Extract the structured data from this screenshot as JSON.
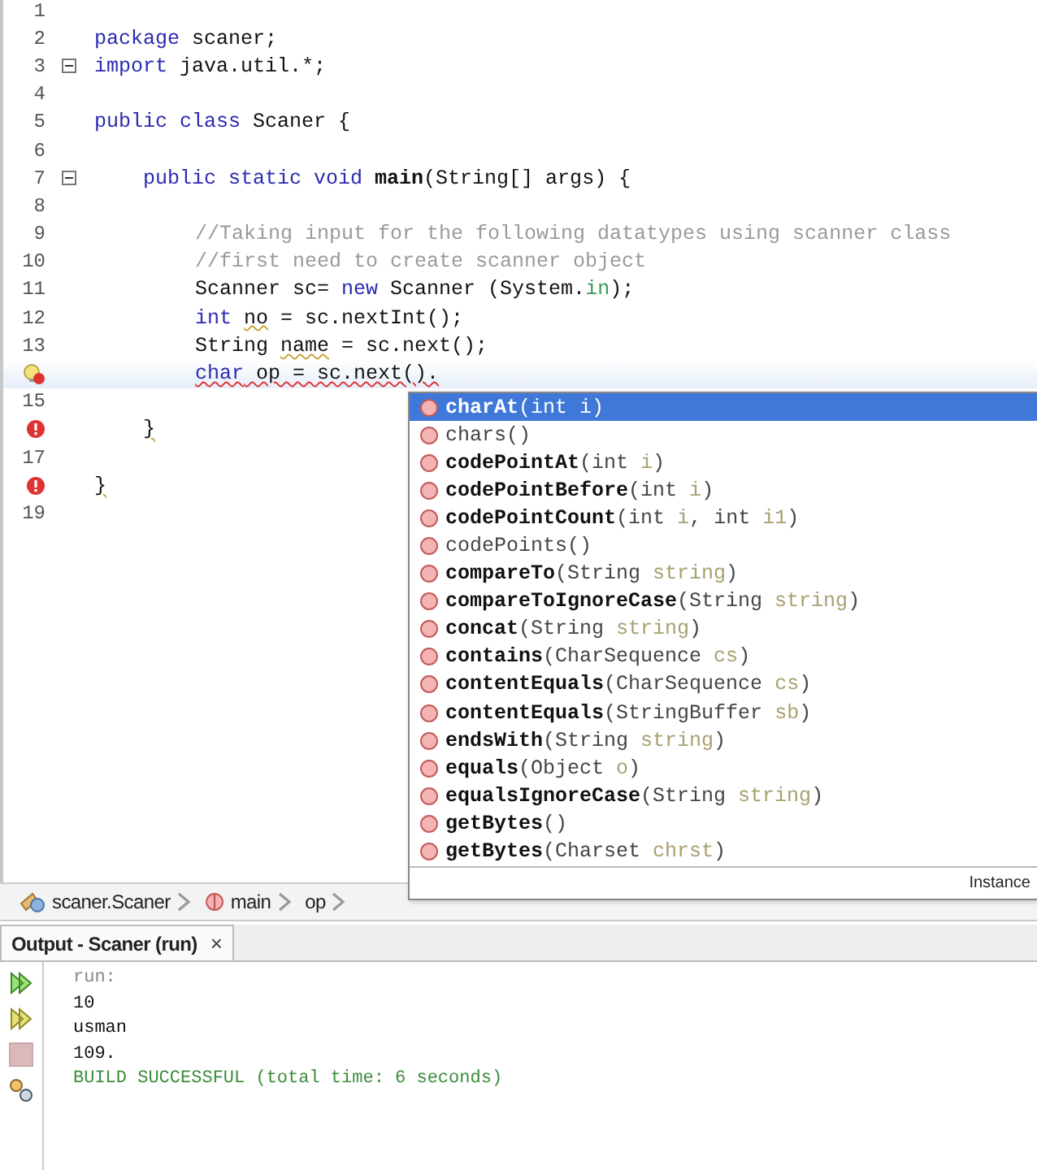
{
  "editor": {
    "lines": [
      {
        "number": "1",
        "error": false,
        "hint": false,
        "fold": false,
        "current": false
      },
      {
        "number": "2",
        "error": false,
        "hint": false,
        "fold": false,
        "current": false,
        "kind": "top",
        "segments": [
          {
            "kind": "keyword",
            "text": "package"
          },
          {
            "kind": "plain",
            "text": " scaner;"
          }
        ]
      },
      {
        "number": "3",
        "error": false,
        "hint": false,
        "fold": true,
        "current": false,
        "kind": "top",
        "segments": [
          {
            "kind": "keyword",
            "text": "import"
          },
          {
            "kind": "plain",
            "text": " java.util.*;"
          }
        ]
      },
      {
        "number": "4",
        "error": false,
        "hint": false,
        "fold": false,
        "current": false
      },
      {
        "number": "5",
        "error": false,
        "hint": false,
        "fold": false,
        "current": false,
        "kind": "top",
        "segments": [
          {
            "kind": "keyword",
            "text": "public class"
          },
          {
            "kind": "plain",
            "text": " Scaner {"
          }
        ]
      },
      {
        "number": "6",
        "error": false,
        "hint": false,
        "fold": false,
        "current": false
      },
      {
        "number": "7",
        "error": false,
        "hint": false,
        "fold": true,
        "current": false,
        "kind": "member",
        "segments": [
          {
            "kind": "keyword",
            "text": "public static void "
          },
          {
            "kind": "bold",
            "text": "main"
          },
          {
            "kind": "plain",
            "text": "(String[] args) {"
          }
        ]
      },
      {
        "number": "8",
        "error": false,
        "hint": false,
        "fold": false,
        "current": false
      },
      {
        "number": "9",
        "error": false,
        "hint": false,
        "fold": false,
        "current": false,
        "kind": "statement",
        "segments": [
          {
            "kind": "comment",
            "text": "//Taking input for the following datatypes using scanner class"
          }
        ]
      },
      {
        "number": "10",
        "error": false,
        "hint": false,
        "fold": false,
        "current": false,
        "kind": "statement",
        "segments": [
          {
            "kind": "comment",
            "text": "//first need to create scanner object"
          }
        ]
      },
      {
        "number": "11",
        "error": false,
        "hint": false,
        "fold": false,
        "current": false,
        "kind": "statement",
        "segments": [
          {
            "kind": "plain",
            "text": "Scanner sc= "
          },
          {
            "kind": "keyword",
            "text": "new"
          },
          {
            "kind": "plain",
            "text": " Scanner (System."
          },
          {
            "kind": "field",
            "text": "in"
          },
          {
            "kind": "plain",
            "text": ");"
          }
        ]
      },
      {
        "number": "12",
        "error": false,
        "hint": false,
        "fold": false,
        "current": false,
        "kind": "statement",
        "segments": [
          {
            "kind": "keyword",
            "text": "int "
          },
          {
            "kind": "plain",
            "text": "no",
            "warning": true
          },
          {
            "kind": "plain",
            "text": " = sc.nextInt();"
          }
        ]
      },
      {
        "number": "13",
        "error": false,
        "hint": false,
        "fold": false,
        "current": false,
        "kind": "statement",
        "segments": [
          {
            "kind": "plain",
            "text": "String "
          },
          {
            "kind": "plain",
            "text": "name",
            "warning": true
          },
          {
            "kind": "plain",
            "text": " = sc.next();"
          }
        ]
      },
      {
        "error": true,
        "hint": true,
        "fold": false,
        "current": true,
        "kind": "statement",
        "segments": [
          {
            "kind": "keyword",
            "text": "char",
            "error": true
          },
          {
            "kind": "plain",
            "text": " op = sc.next().",
            "error": true
          }
        ]
      },
      {
        "number": "15",
        "error": false,
        "hint": false,
        "fold": false,
        "current": false
      },
      {
        "error": true,
        "hint": false,
        "fold": false,
        "current": false,
        "kind": "member",
        "segments": [
          {
            "kind": "plain",
            "text": "}",
            "warning": true
          }
        ]
      },
      {
        "number": "17",
        "error": false,
        "hint": false,
        "fold": false,
        "current": false
      },
      {
        "error": true,
        "hint": false,
        "fold": false,
        "current": false,
        "kind": "top",
        "segments": [
          {
            "kind": "plain",
            "text": "}",
            "warning": true
          }
        ]
      },
      {
        "number": "19",
        "error": false,
        "hint": false,
        "fold": false,
        "current": false
      }
    ]
  },
  "completion": {
    "items": [
      {
        "selected": true,
        "segments": [
          {
            "kind": "method",
            "text": "charAt"
          },
          {
            "kind": "type",
            "text": "(int "
          },
          {
            "kind": "param",
            "text": "i"
          },
          {
            "kind": "type",
            "text": ")"
          }
        ]
      },
      {
        "selected": false,
        "segments": [
          {
            "kind": "type",
            "text": "chars()"
          }
        ]
      },
      {
        "selected": false,
        "segments": [
          {
            "kind": "method",
            "text": "codePointAt"
          },
          {
            "kind": "type",
            "text": "(int "
          },
          {
            "kind": "param",
            "text": "i"
          },
          {
            "kind": "type",
            "text": ")"
          }
        ]
      },
      {
        "selected": false,
        "segments": [
          {
            "kind": "method",
            "text": "codePointBefore"
          },
          {
            "kind": "type",
            "text": "(int "
          },
          {
            "kind": "param",
            "text": "i"
          },
          {
            "kind": "type",
            "text": ")"
          }
        ]
      },
      {
        "selected": false,
        "segments": [
          {
            "kind": "method",
            "text": "codePointCount"
          },
          {
            "kind": "type",
            "text": "(int "
          },
          {
            "kind": "param",
            "text": "i"
          },
          {
            "kind": "type",
            "text": ", int "
          },
          {
            "kind": "param",
            "text": "i1"
          },
          {
            "kind": "type",
            "text": ")"
          }
        ]
      },
      {
        "selected": false,
        "segments": [
          {
            "kind": "type",
            "text": "codePoints()"
          }
        ]
      },
      {
        "selected": false,
        "segments": [
          {
            "kind": "method",
            "text": "compareTo"
          },
          {
            "kind": "type",
            "text": "(String "
          },
          {
            "kind": "param",
            "text": "string"
          },
          {
            "kind": "type",
            "text": ")"
          }
        ]
      },
      {
        "selected": false,
        "segments": [
          {
            "kind": "method",
            "text": "compareToIgnoreCase"
          },
          {
            "kind": "type",
            "text": "(String "
          },
          {
            "kind": "param",
            "text": "string"
          },
          {
            "kind": "type",
            "text": ")"
          }
        ]
      },
      {
        "selected": false,
        "segments": [
          {
            "kind": "method",
            "text": "concat"
          },
          {
            "kind": "type",
            "text": "(String "
          },
          {
            "kind": "param",
            "text": "string"
          },
          {
            "kind": "type",
            "text": ")"
          }
        ]
      },
      {
        "selected": false,
        "segments": [
          {
            "kind": "method",
            "text": "contains"
          },
          {
            "kind": "type",
            "text": "(CharSequence "
          },
          {
            "kind": "param",
            "text": "cs"
          },
          {
            "kind": "type",
            "text": ")"
          }
        ]
      },
      {
        "selected": false,
        "segments": [
          {
            "kind": "method",
            "text": "contentEquals"
          },
          {
            "kind": "type",
            "text": "(CharSequence "
          },
          {
            "kind": "param",
            "text": "cs"
          },
          {
            "kind": "type",
            "text": ")"
          }
        ]
      },
      {
        "selected": false,
        "segments": [
          {
            "kind": "method",
            "text": "contentEquals"
          },
          {
            "kind": "type",
            "text": "(StringBuffer "
          },
          {
            "kind": "param",
            "text": "sb"
          },
          {
            "kind": "type",
            "text": ")"
          }
        ]
      },
      {
        "selected": false,
        "segments": [
          {
            "kind": "method",
            "text": "endsWith"
          },
          {
            "kind": "type",
            "text": "(String "
          },
          {
            "kind": "param",
            "text": "string"
          },
          {
            "kind": "type",
            "text": ")"
          }
        ]
      },
      {
        "selected": false,
        "segments": [
          {
            "kind": "method",
            "text": "equals"
          },
          {
            "kind": "type",
            "text": "(Object "
          },
          {
            "kind": "param",
            "text": "o"
          },
          {
            "kind": "type",
            "text": ")"
          }
        ]
      },
      {
        "selected": false,
        "segments": [
          {
            "kind": "method",
            "text": "equalsIgnoreCase"
          },
          {
            "kind": "type",
            "text": "(String "
          },
          {
            "kind": "param",
            "text": "string"
          },
          {
            "kind": "type",
            "text": ")"
          }
        ]
      },
      {
        "selected": false,
        "segments": [
          {
            "kind": "method",
            "text": "getBytes"
          },
          {
            "kind": "type",
            "text": "()"
          }
        ]
      },
      {
        "selected": false,
        "segments": [
          {
            "kind": "method",
            "text": "getBytes"
          },
          {
            "kind": "type",
            "text": "(Charset "
          },
          {
            "kind": "param",
            "text": "chrst"
          },
          {
            "kind": "type",
            "text": ")"
          }
        ]
      }
    ],
    "footer": "Instance"
  },
  "breadcrumbs": [
    {
      "kind": "class",
      "label": "scaner.Scaner"
    },
    {
      "kind": "method",
      "label": "main"
    },
    {
      "kind": "variable",
      "label": "op"
    }
  ],
  "output": {
    "tab": "Output - Scaner (run)",
    "close": "×",
    "lines": [
      {
        "kind": "info",
        "text": "run:"
      },
      {
        "kind": "plain",
        "text": "10"
      },
      {
        "kind": "plain",
        "text": "usman"
      },
      {
        "kind": "plain",
        "text": "109."
      },
      {
        "kind": "success",
        "text": "BUILD SUCCESSFUL (total time: 6 seconds)"
      }
    ]
  }
}
